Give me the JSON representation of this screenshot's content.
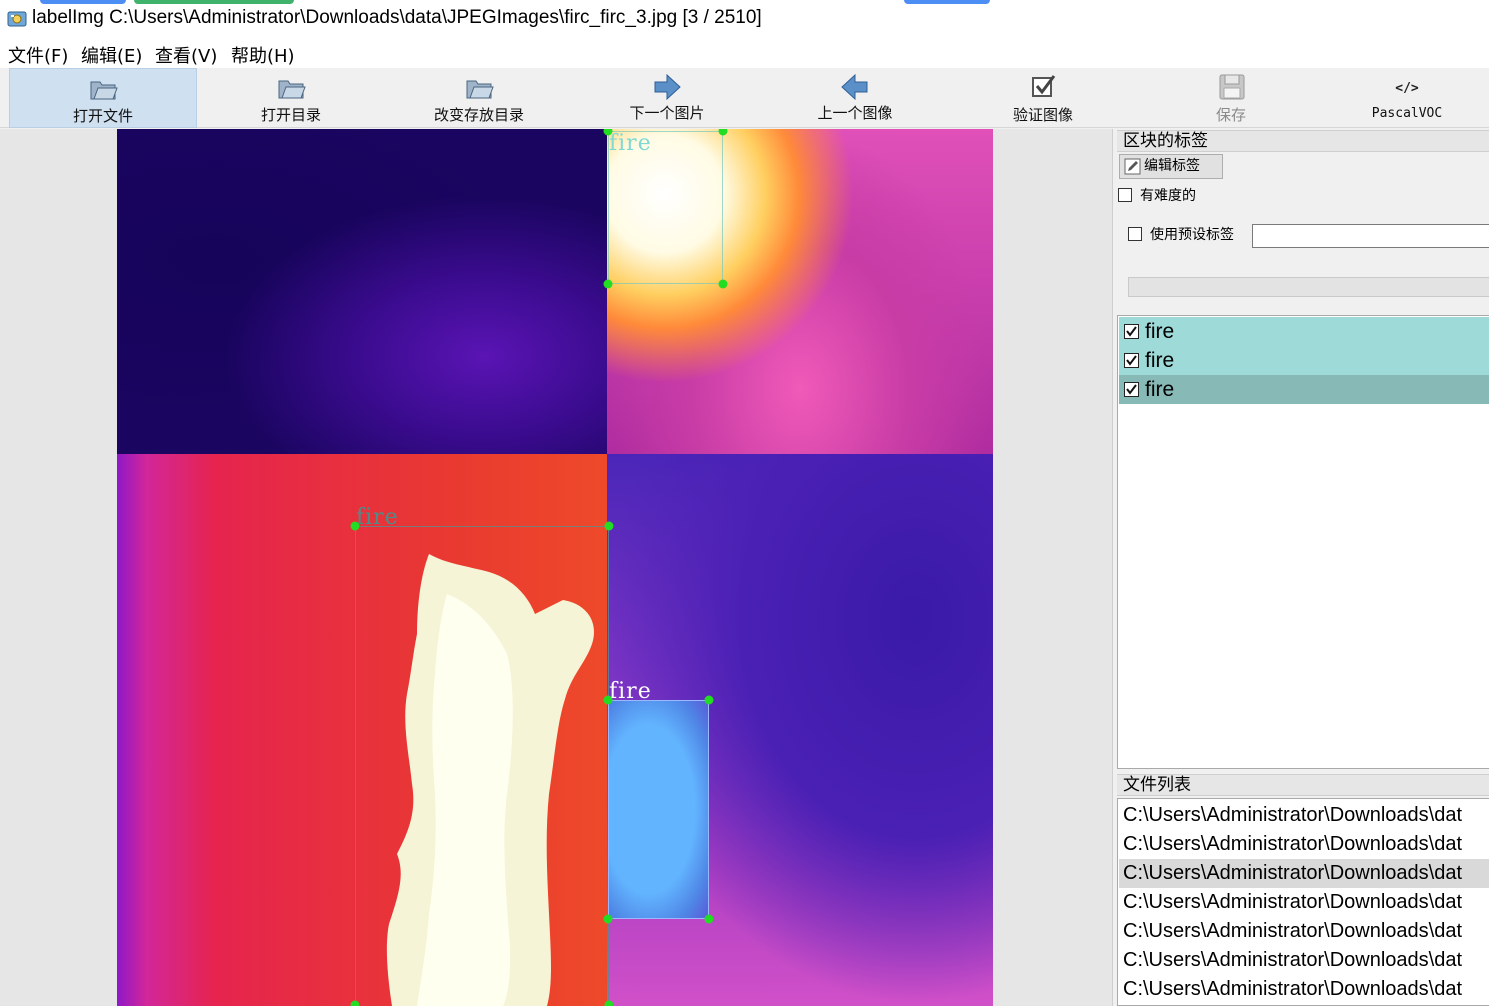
{
  "window": {
    "title": "labelImg C:\\Users\\Administrator\\Downloads\\data\\JPEGImages\\firc_firc_3.jpg [3 / 2510]"
  },
  "menu": [
    {
      "label": "文件(F)"
    },
    {
      "label": "编辑(E)"
    },
    {
      "label": "查看(V)"
    },
    {
      "label": "帮助(H)"
    }
  ],
  "toolbar": {
    "open_file": "打开文件",
    "open_dir": "打开目录",
    "change_save_dir": "改变存放目录",
    "next_image": "下一个图片",
    "prev_image": "上一个图像",
    "verify_image": "验证图像",
    "save": "保存",
    "format": "PascalVOC"
  },
  "annotations": [
    {
      "label": "fire"
    },
    {
      "label": "fire"
    },
    {
      "label": "fire"
    }
  ],
  "panel": {
    "box_labels_title": "区块的标签",
    "edit_label_button": "编辑标签",
    "difficult_checkbox": "有难度的",
    "use_default_label_checkbox": "使用预设标签",
    "default_label_value": "",
    "labels": [
      {
        "name": "fire",
        "checked": true
      },
      {
        "name": "fire",
        "checked": true
      },
      {
        "name": "fire",
        "checked": true,
        "selected": true
      }
    ],
    "file_list_title": "文件列表",
    "files": [
      "C:\\Users\\Administrator\\Downloads\\dat",
      "C:\\Users\\Administrator\\Downloads\\dat",
      "C:\\Users\\Administrator\\Downloads\\dat",
      "C:\\Users\\Administrator\\Downloads\\dat",
      "C:\\Users\\Administrator\\Downloads\\dat",
      "C:\\Users\\Administrator\\Downloads\\dat",
      "C:\\Users\\Administrator\\Downloads\\dat"
    ],
    "current_file_index": 2
  },
  "colors": {
    "label_row": "#9ddad8",
    "label_row_selected": "#87bab7",
    "handle": "#22dd22",
    "active_tool": "#cfe0f0"
  }
}
